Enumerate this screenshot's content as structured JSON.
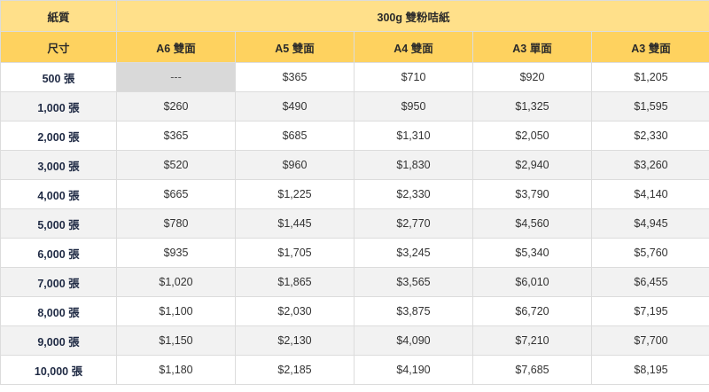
{
  "table": {
    "corner_label_1": "紙質",
    "corner_label_2": "尺寸",
    "paper": "300g 雙粉咭紙",
    "sizes": [
      "A6 雙面",
      "A5 雙面",
      "A4 雙面",
      "A3 單面",
      "A3 雙面"
    ],
    "rows": [
      {
        "qty": "500 張",
        "prices": [
          "---",
          "$365",
          "$710",
          "$920",
          "$1,205"
        ]
      },
      {
        "qty": "1,000 張",
        "prices": [
          "$260",
          "$490",
          "$950",
          "$1,325",
          "$1,595"
        ]
      },
      {
        "qty": "2,000 張",
        "prices": [
          "$365",
          "$685",
          "$1,310",
          "$2,050",
          "$2,330"
        ]
      },
      {
        "qty": "3,000 張",
        "prices": [
          "$520",
          "$960",
          "$1,830",
          "$2,940",
          "$3,260"
        ]
      },
      {
        "qty": "4,000 張",
        "prices": [
          "$665",
          "$1,225",
          "$2,330",
          "$3,790",
          "$4,140"
        ]
      },
      {
        "qty": "5,000 張",
        "prices": [
          "$780",
          "$1,445",
          "$2,770",
          "$4,560",
          "$4,945"
        ]
      },
      {
        "qty": "6,000 張",
        "prices": [
          "$935",
          "$1,705",
          "$3,245",
          "$5,340",
          "$5,760"
        ]
      },
      {
        "qty": "7,000 張",
        "prices": [
          "$1,020",
          "$1,865",
          "$3,565",
          "$6,010",
          "$6,455"
        ]
      },
      {
        "qty": "8,000 張",
        "prices": [
          "$1,100",
          "$2,030",
          "$3,875",
          "$6,720",
          "$7,195"
        ]
      },
      {
        "qty": "9,000 張",
        "prices": [
          "$1,150",
          "$2,130",
          "$4,090",
          "$7,210",
          "$7,700"
        ]
      },
      {
        "qty": "10,000 張",
        "prices": [
          "$1,180",
          "$2,185",
          "$4,190",
          "$7,685",
          "$8,195"
        ]
      }
    ]
  },
  "colors": {
    "header_top": "#ffe08a",
    "header_sizes": "#fed25f",
    "row_alt": "#f2f2f2",
    "na_cell": "#d9d9d9",
    "text": "#1f2a44"
  }
}
